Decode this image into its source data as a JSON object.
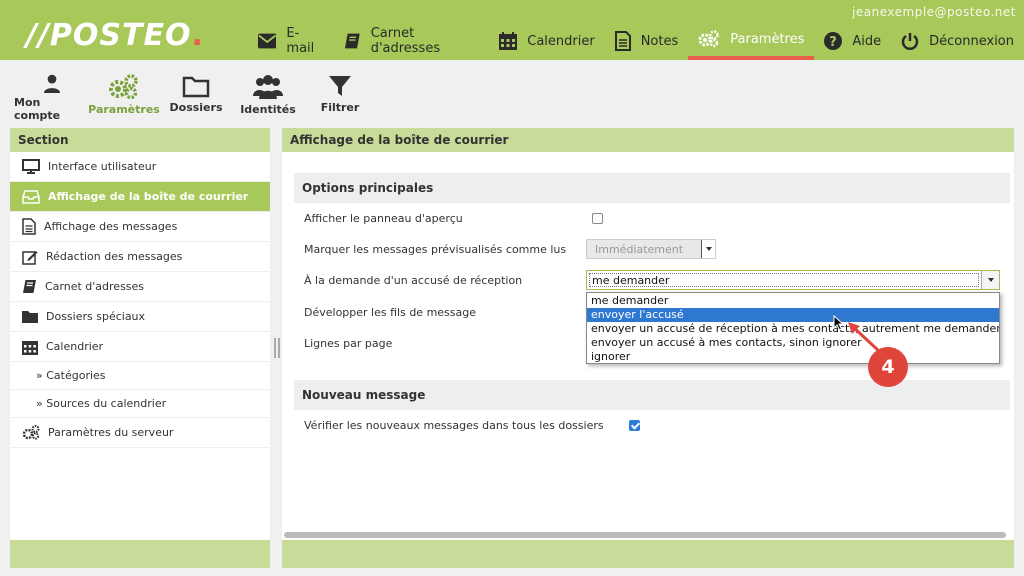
{
  "header": {
    "logo_text": "//POSTEO",
    "logo_dot": ".",
    "user_email": "jeanexemple@posteo.net",
    "nav": [
      {
        "label": "E-mail",
        "icon": "envelope-icon"
      },
      {
        "label": "Carnet d'adresses",
        "icon": "address-book-icon"
      },
      {
        "label": "Calendrier",
        "icon": "calendar-icon"
      },
      {
        "label": "Notes",
        "icon": "notes-icon"
      },
      {
        "label": "Paramètres",
        "icon": "gears-icon",
        "active": true
      },
      {
        "label": "Aide",
        "icon": "help-icon"
      },
      {
        "label": "Déconnexion",
        "icon": "power-icon"
      }
    ]
  },
  "toolbar": {
    "items": [
      {
        "label": "Mon compte",
        "icon": "user-icon"
      },
      {
        "label": "Paramètres",
        "icon": "gears-icon",
        "active": true
      },
      {
        "label": "Dossiers",
        "icon": "folder-icon"
      },
      {
        "label": "Identités",
        "icon": "users-icon"
      },
      {
        "label": "Filtrer",
        "icon": "filter-icon"
      }
    ]
  },
  "sidebar": {
    "title": "Section",
    "items": [
      {
        "label": "Interface utilisateur",
        "icon": "monitor-icon"
      },
      {
        "label": "Affichage de la boîte de courrier",
        "icon": "inbox-icon",
        "active": true
      },
      {
        "label": "Affichage des messages",
        "icon": "document-icon"
      },
      {
        "label": "Rédaction des messages",
        "icon": "edit-icon"
      },
      {
        "label": "Carnet d'adresses",
        "icon": "address-book-icon"
      },
      {
        "label": "Dossiers spéciaux",
        "icon": "folder-icon"
      },
      {
        "label": "Calendrier",
        "icon": "calendar-icon"
      },
      {
        "label": "» Catégories",
        "sub": true
      },
      {
        "label": "» Sources du calendrier",
        "sub": true
      },
      {
        "label": "Paramètres du serveur",
        "icon": "gears-icon"
      }
    ]
  },
  "main": {
    "title": "Affichage de la boîte de courrier",
    "group1_title": "Options principales",
    "preview_label": "Afficher le panneau d'aperçu",
    "preview_checked": false,
    "mark_read_label": "Marquer les messages prévisualisés comme lus",
    "mark_read_value": "Immédiatement",
    "receipt_label": "À la demande d'un accusé de réception",
    "receipt_value": "me demander",
    "receipt_options": [
      "me demander",
      "envoyer l'accusé",
      "envoyer un accusé de réception à mes contacts, autrement me demander",
      "envoyer un accusé à mes contacts, sinon ignorer",
      "ignorer"
    ],
    "receipt_highlighted_index": 1,
    "threads_label": "Développer les fils de message",
    "lines_label": "Lignes par page",
    "group2_title": "Nouveau message",
    "check_all_label": "Vérifier les nouveaux messages dans tous les dossiers",
    "check_all_checked": true
  },
  "annotation": {
    "step": "4",
    "color": "#e0453c"
  },
  "colors": {
    "brand_green": "#a8c85a",
    "light_green": "#c8dc9a",
    "accent_red": "#e8604c",
    "select_blue": "#2e78d2"
  }
}
